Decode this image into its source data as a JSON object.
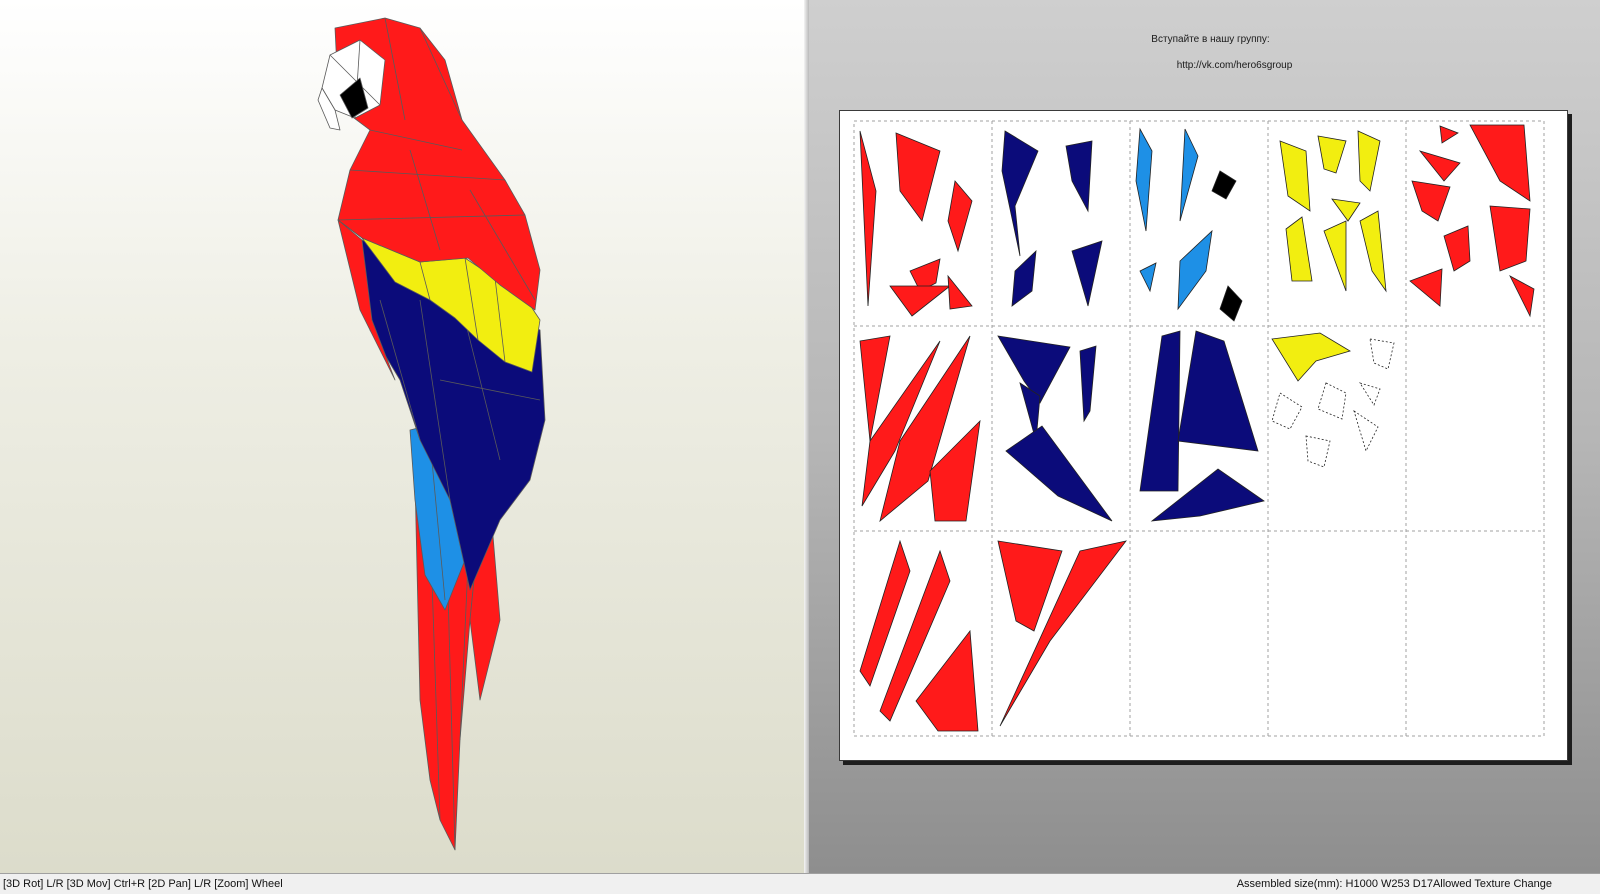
{
  "view_3d": {
    "model": "parrot-3d-model"
  },
  "view_2d": {
    "promo_line1": "Вступайте в нашу группу:",
    "promo_line2": "http://vk.com/hero6sgroup"
  },
  "status_bar": {
    "controls_hint": "[3D Rot] L/R [3D Mov] Ctrl+R [2D Pan] L/R [Zoom] Wheel",
    "info": "Assembled size(mm): H1000 W253 D17Allowed Texture Change"
  },
  "colors": {
    "red": "#ff1a1a",
    "navy": "#0b0b7a",
    "sky_blue": "#1e90e6",
    "yellow": "#f2ee10",
    "white": "#ffffff",
    "black": "#000000"
  },
  "icons": [
    "parrot-3d-model",
    "papercraft-pattern-sheet"
  ]
}
